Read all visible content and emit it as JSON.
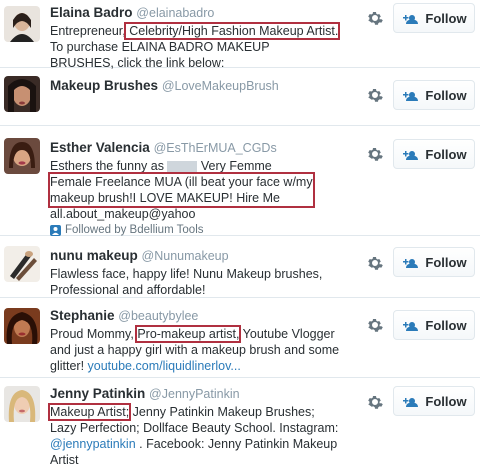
{
  "follow_label": "Follow",
  "accent": "#2b7bb9",
  "highlight_color": "#b03040",
  "users": [
    {
      "name": "Elaina Badro",
      "handle": "@elainabadro",
      "bio_pre": "Entrepreneur,",
      "bio_highlight": " Celebrity/High Fashion Makeup Artist.",
      "bio_post": "\n  To purchase ELAINA BADRO MAKEUP\nBRUSHES, click the link below:"
    },
    {
      "name": "Makeup Brushes",
      "handle": "@LoveMakeupBrush"
    },
    {
      "name": "Esther Valencia",
      "handle": "@EsThErMUA_CGDs",
      "bio_line1": "Esthers the funny as",
      "bio_line1_end": " Very Femme",
      "bio_highlight": "Female Freelance MUA (ill beat your face w/my\nmakeup brush!⁣I LOVE MAKEUP!⁣ Hire Me",
      "bio_post": "all.about_makeup@yahoo",
      "followed_by": "Followed by Bdellium Tools"
    },
    {
      "name": "nunu makeup",
      "handle": "@Nunumakeup",
      "bio": "Flawless face, happy life! Nunu Makeup brushes,\nProfessional and affordable!"
    },
    {
      "name": "Stephanie",
      "handle": "@beautybylee",
      "bio_pre": "Proud Mommy,",
      "bio_highlight": "Pro-makeup artist,",
      "bio_post": " Youtube Vlogger\nand just a happy girl with a makeup brush and some\nglitter!",
      "bio_link": "youtube.com/liquidlinerlov..."
    },
    {
      "name": "Jenny Patinkin",
      "handle": "@JennyPatinkin",
      "bio_highlight": "Makeup Artist;",
      "bio_post": " Jenny Patinkin Makeup Brushes;\nLazy Perfection; Dollface Beauty School. Instagram:\n",
      "bio_link": "@jennypatinkin",
      "bio_tail": " . Facebook: Jenny Patinkin Makeup\nArtist"
    }
  ]
}
